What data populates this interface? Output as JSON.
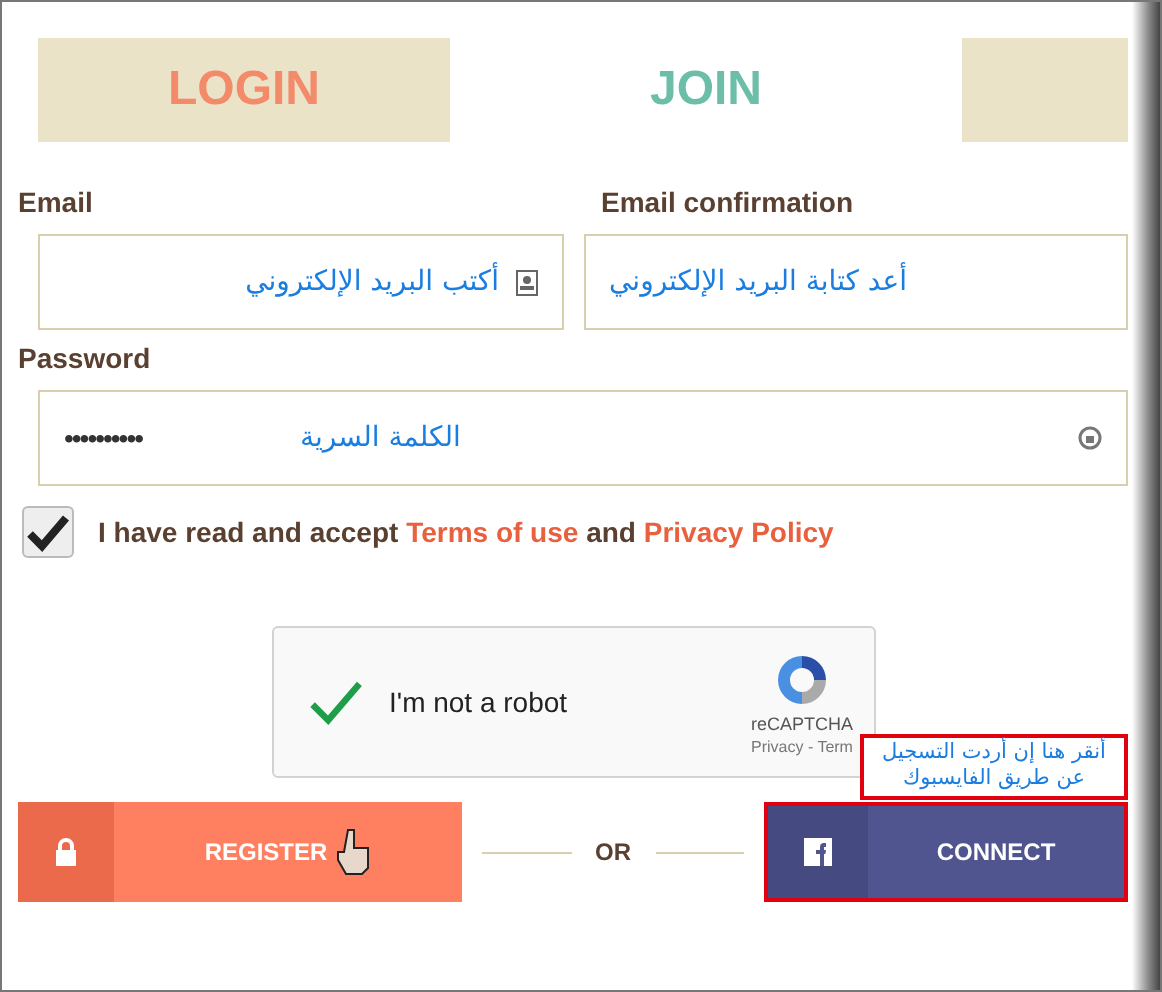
{
  "tabs": [
    {
      "label": "LOGIN",
      "selected": false
    },
    {
      "label": "JOIN",
      "selected": true
    },
    {
      "selected": false
    }
  ],
  "email": {
    "label": "Email",
    "hint": "أكتب البريد الإلكتروني"
  },
  "email_confirmation": {
    "label": "Email confirmation",
    "hint": "أعد كتابة البريد الإلكتروني"
  },
  "password": {
    "label": "Password",
    "value": "••••••••••",
    "hint": "الكلمة السرية"
  },
  "terms": {
    "checked": true,
    "before": "I have read and accept",
    "terms_link": "Terms of use",
    "middle": "and",
    "privacy_link": "Privacy Policy"
  },
  "captcha": {
    "checked": true,
    "label": "I'm not a robot",
    "brand": "reCAPTCHA",
    "links": "Privacy - Term"
  },
  "register_button": "REGISTER",
  "separator": "OR",
  "connect_button": "CONNECT",
  "facebook_note": "أنقر هنا إن أردت التسجيل عن طريق الفايسبوك"
}
